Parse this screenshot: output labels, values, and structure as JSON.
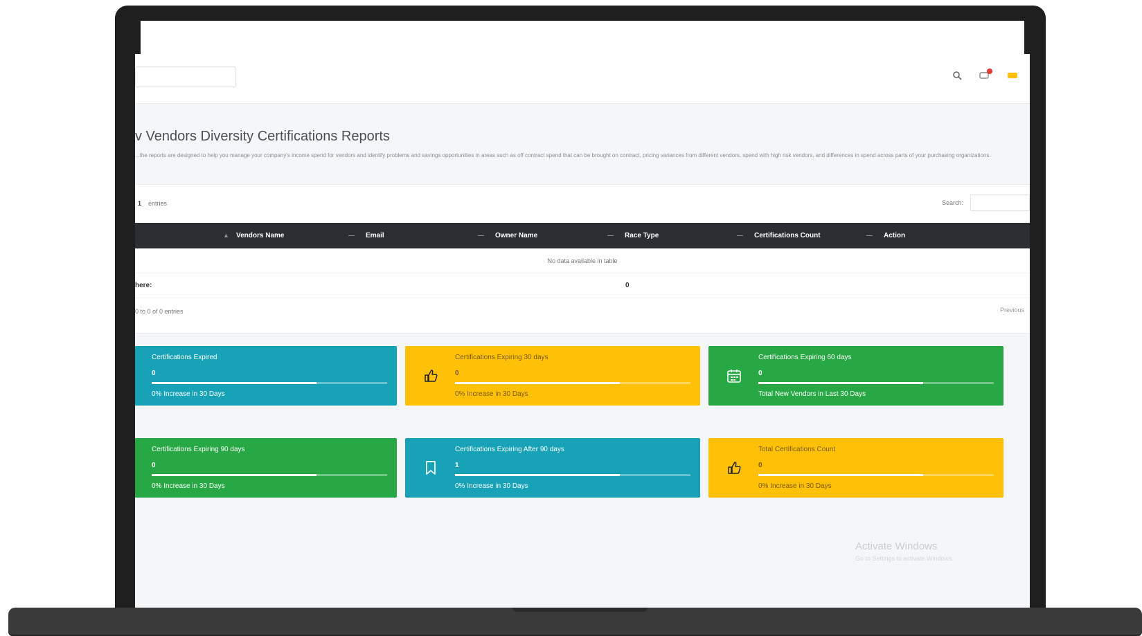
{
  "header": {
    "title": "v Vendors Diversity Certifications Reports",
    "description": "...the reports are designed to help you manage your company's income spend for vendors and identify problems and savings opportunities in areas such as off contract spend that can be brought on contract, pricing variances from different vendors, spend with high risk vendors, and differences in spend across parts of your purchasing organizations."
  },
  "table": {
    "length_value": "1",
    "length_label": "entries",
    "search_label": "Search:",
    "columns": [
      "Vendors Name",
      "Email",
      "Owner Name",
      "Race Type",
      "Certifications Count",
      "Action"
    ],
    "empty_message": "No data available in table",
    "footer_label": "here:",
    "footer_value": "0",
    "info": "0 to 0 of 0 entries",
    "previous": "Previous"
  },
  "cards": [
    {
      "title": "Certifications Expired",
      "value": "0",
      "subtitle": "0% Increase in 30 Days",
      "color": "#17a2b8",
      "icon": "bookmark-icon",
      "progress": 0.7
    },
    {
      "title": "Certifications Expiring 30 days",
      "value": "0",
      "subtitle": "0% Increase in 30 Days",
      "color": "#ffc107",
      "icon": "thumbs-up-icon",
      "progress": 0.7
    },
    {
      "title": "Certifications Expiring 60 days",
      "value": "0",
      "subtitle": "Total New Vendors in Last 30 Days",
      "color": "#28a745",
      "icon": "calendar-icon",
      "progress": 0.7
    },
    {
      "title": "Certifications Expiring 90 days",
      "value": "0",
      "subtitle": "0% Increase in 30 Days",
      "color": "#28a745",
      "icon": "thumbs-up-icon",
      "progress": 0.7
    },
    {
      "title": "Certifications Expiring After 90 days",
      "value": "1",
      "subtitle": "0% Increase in 30 Days",
      "color": "#17a2b8",
      "icon": "bookmark-icon",
      "progress": 0.7
    },
    {
      "title": "Total Certifications Count",
      "value": "0",
      "subtitle": "0% Increase in 30 Days",
      "color": "#ffc107",
      "icon": "thumbs-up-icon",
      "progress": 0.7
    }
  ],
  "watermark": {
    "line1": "Activate Windows",
    "line2": "Go to Settings to activate Windows."
  },
  "topbar_icons": [
    "search-icon",
    "notification-icon",
    "message-icon"
  ]
}
